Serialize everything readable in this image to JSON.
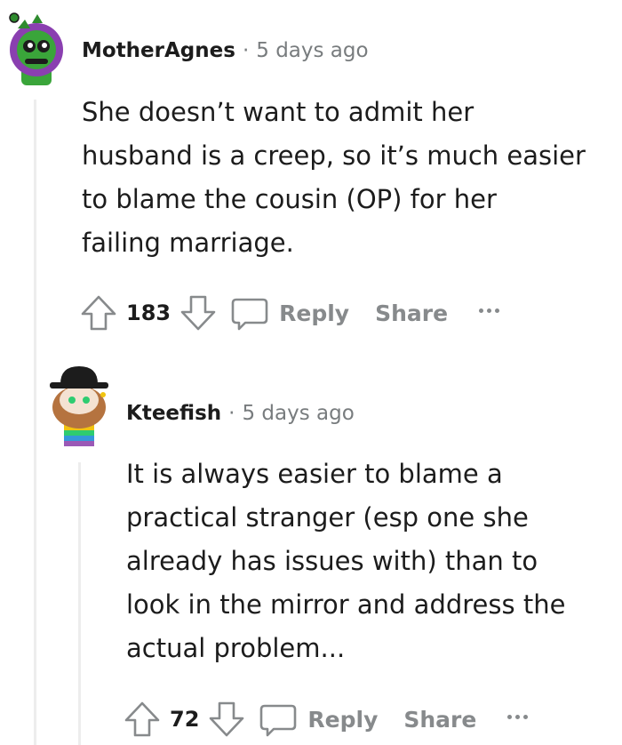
{
  "comments": [
    {
      "username": "MotherAgnes",
      "separator": "·",
      "time": "5 days ago",
      "lines": [
        "She doesn’t want to admit her",
        "husband is a creep, so it’s much easier",
        "to blame the cousin (OP) for her",
        "failing marriage."
      ],
      "votes": "183",
      "reply_label": "Reply",
      "share_label": "Share"
    },
    {
      "username": "Kteefish",
      "separator": "·",
      "time": "5 days ago",
      "lines": [
        "It is always easier to blame a",
        "practical stranger (esp one she",
        "already has issues with) than to",
        "look in the mirror and address the",
        "actual problem..."
      ],
      "votes": "72",
      "reply_label": "Reply",
      "share_label": "Share"
    }
  ],
  "colors": {
    "text": "#1c1c1c",
    "muted": "#787c7e",
    "action": "#878a8c",
    "thread_line": "#ededed"
  }
}
